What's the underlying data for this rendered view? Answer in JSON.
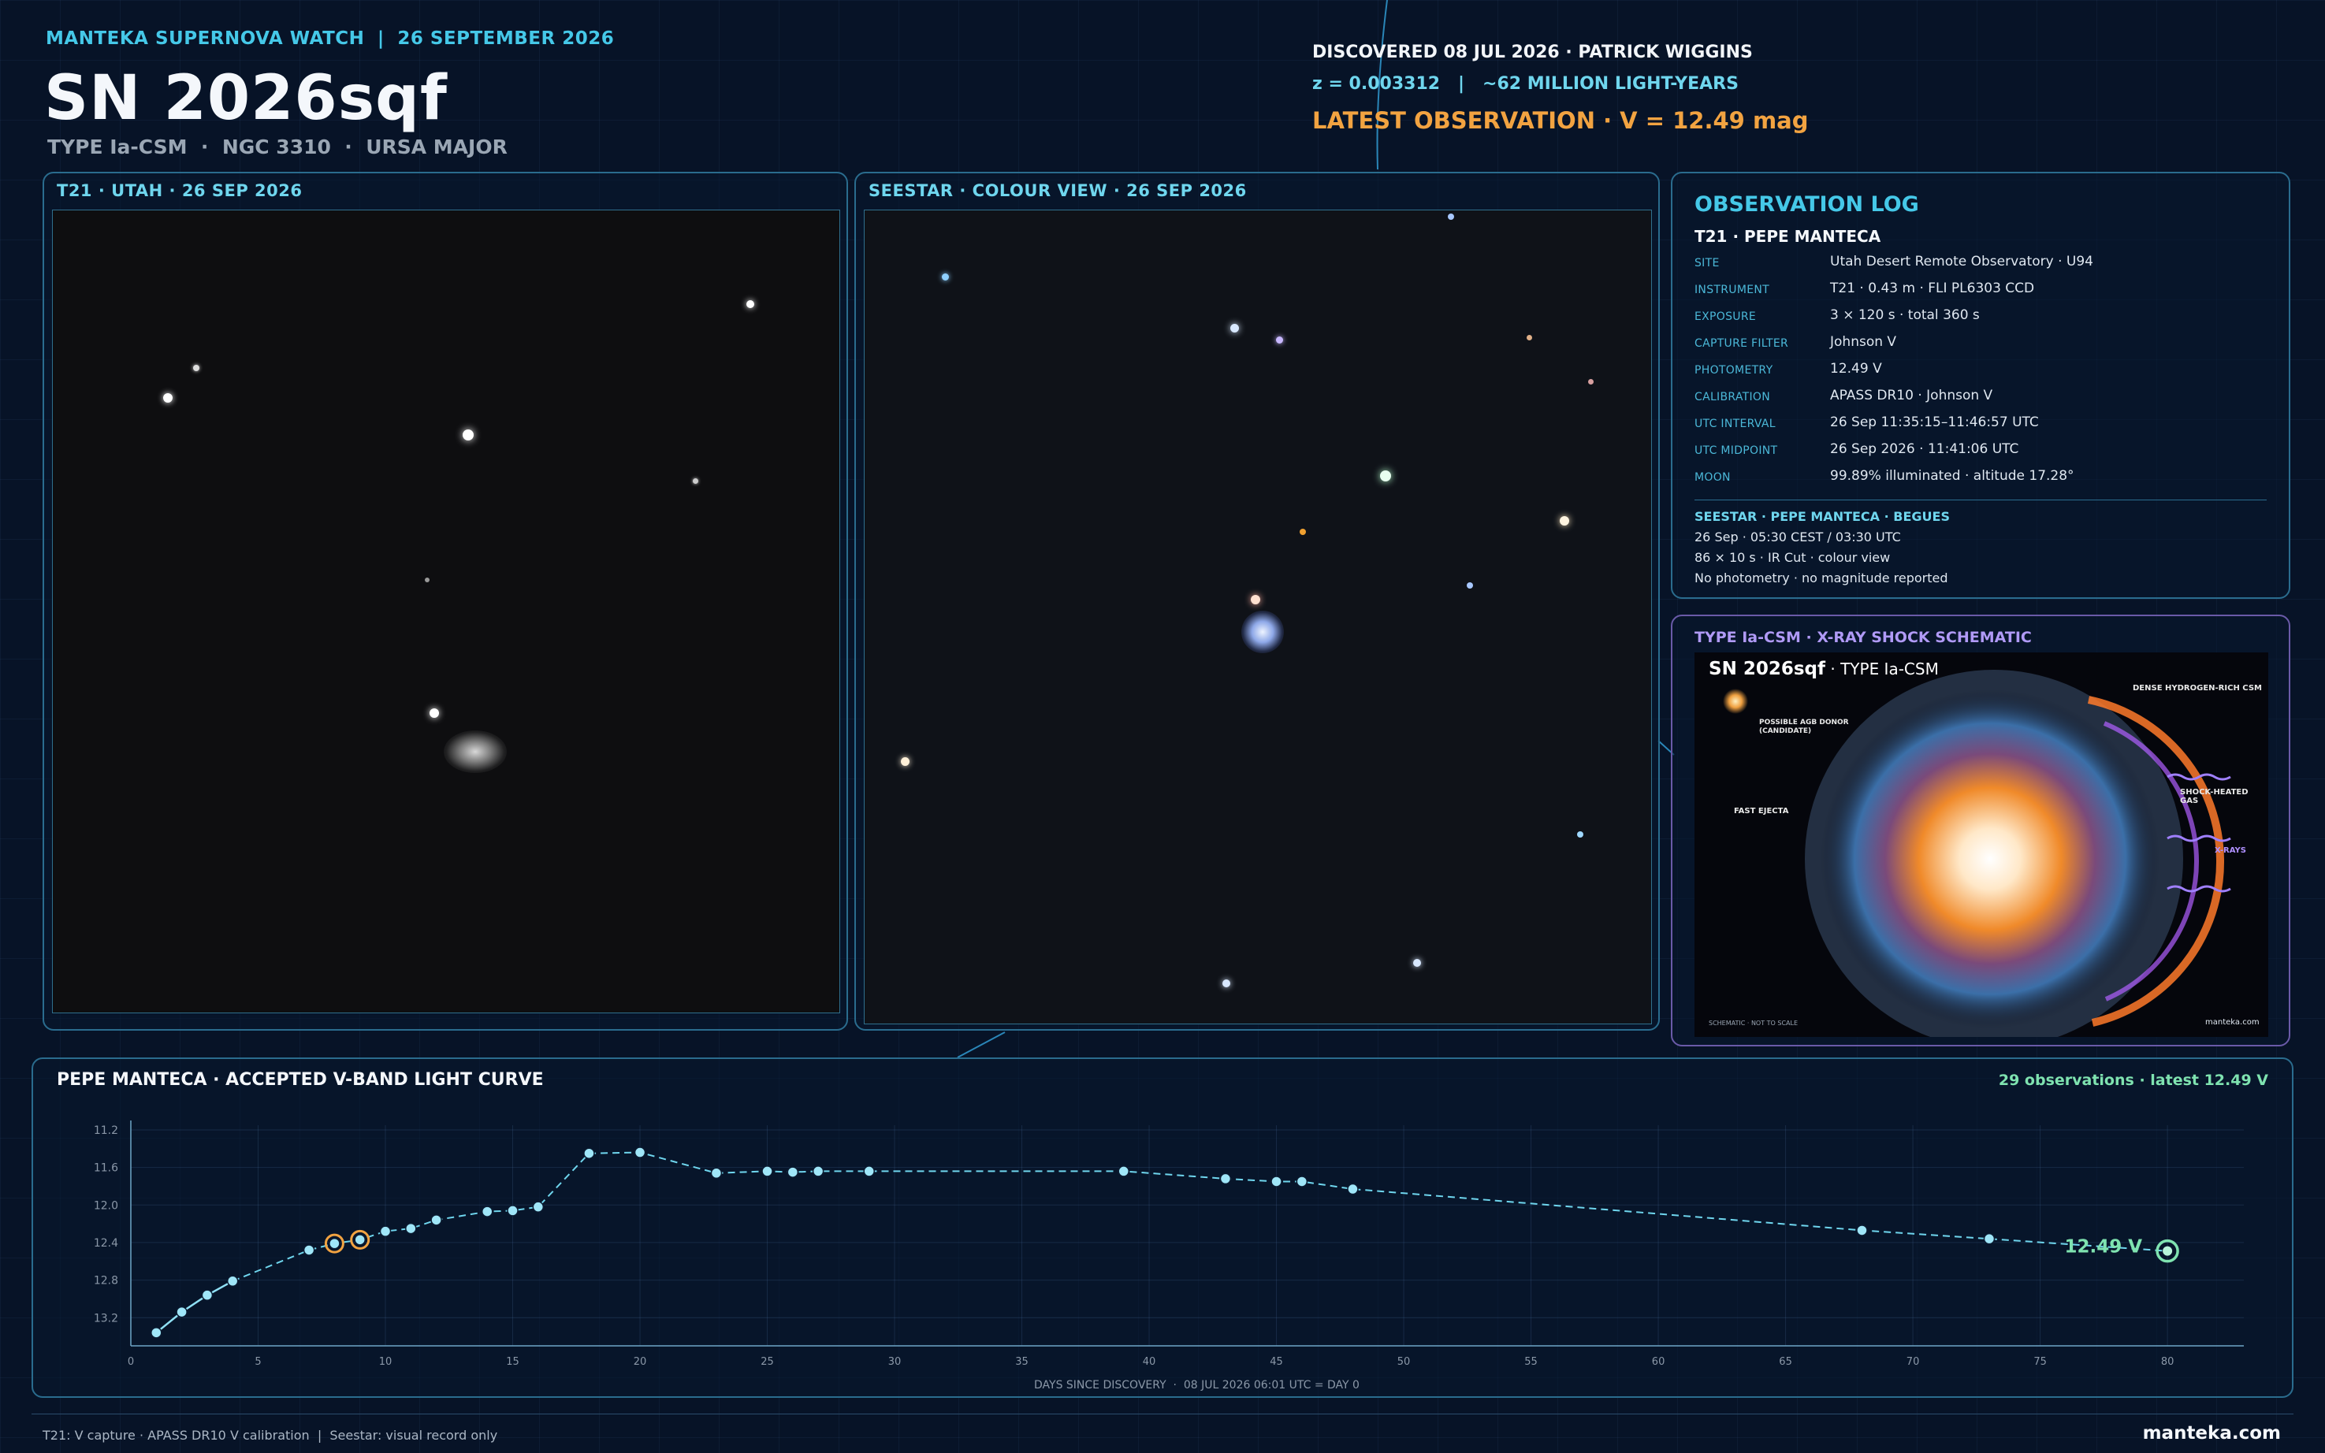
{
  "header": {
    "brand": "MANTEKA SUPERNOVA WATCH",
    "separator": "|",
    "date": "26 SEPTEMBER 2026",
    "title": "SN 2026sqf",
    "subtitle": "TYPE Ia-CSM  ·  NGC 3310  ·  URSA MAJOR",
    "discovered": "DISCOVERED 08 JUL 2026 · PATRICK WIGGINS",
    "redshift": "z = 0.003312   |   ~62 MILLION LIGHT-YEARS",
    "latest": "LATEST OBSERVATION  ·  V = 12.49 mag"
  },
  "t21_panel": {
    "title": "T21 · UTAH · 26 SEP 2026"
  },
  "seestar_panel": {
    "title": "SEESTAR · COLOUR VIEW · 26 SEP 2026"
  },
  "log": {
    "title": "OBSERVATION LOG",
    "subtitle": "T21 · PEPE MANTECA",
    "rows": [
      {
        "key": "SITE",
        "value": "Utah Desert Remote Observatory · U94"
      },
      {
        "key": "INSTRUMENT",
        "value": "T21 · 0.43 m · FLI PL6303 CCD"
      },
      {
        "key": "EXPOSURE",
        "value": "3 × 120 s · total 360 s"
      },
      {
        "key": "CAPTURE FILTER",
        "value": "Johnson V"
      },
      {
        "key": "PHOTOMETRY",
        "value": "12.49 V"
      },
      {
        "key": "CALIBRATION",
        "value": "APASS DR10 · Johnson V"
      },
      {
        "key": "UTC INTERVAL",
        "value": "26 Sep 11:35:15–11:46:57 UTC"
      },
      {
        "key": "UTC MIDPOINT",
        "value": "26 Sep 2026 · 11:41:06 UTC"
      },
      {
        "key": "MOON",
        "value": "99.89% illuminated · altitude 17.28°"
      }
    ],
    "seestar_title": "SEESTAR · PEPE MANTECA · BEGUES",
    "seestar_lines": [
      "26 Sep · 05:30 CEST / 03:30 UTC",
      "86 × 10 s · IR Cut · colour view",
      "No photometry · no magnitude reported"
    ]
  },
  "schematic": {
    "title": "TYPE Ia-CSM · X-RAY SHOCK SCHEMATIC",
    "name": "SN 2026sqf",
    "type": " · TYPE Ia-CSM",
    "donor": "POSSIBLE AGB DONOR",
    "donor2": "(CANDIDATE)",
    "csm": "DENSE HYDROGEN-RICH CSM",
    "ejecta": "FAST EJECTA",
    "shock": "SHOCK-HEATED GAS",
    "xrays": "X-RAYS",
    "note": "SCHEMATIC · NOT TO SCALE",
    "credit": "manteka.com"
  },
  "curve": {
    "title": "PEPE MANTECA · ACCEPTED V-BAND LIGHT CURVE",
    "summary": "29 observations · latest 12.49 V",
    "xlabel": "DAYS SINCE DISCOVERY  ·  08 JUL 2026 06:01 UTC = DAY 0",
    "latest_label": "12.49 V"
  },
  "chart_data": {
    "type": "line",
    "title": "PEPE MANTECA · ACCEPTED V-BAND LIGHT CURVE",
    "xlabel": "DAYS SINCE DISCOVERY  ·  08 JUL 2026 06:01 UTC = DAY 0",
    "ylabel": "",
    "xlim": [
      0,
      83
    ],
    "ylim": [
      13.5,
      11.15
    ],
    "y_inverted": true,
    "grid": true,
    "xticks": [
      0,
      5,
      10,
      15,
      20,
      25,
      30,
      35,
      40,
      45,
      50,
      55,
      60,
      65,
      70,
      75,
      80
    ],
    "yticks": [
      11.2,
      11.6,
      12.0,
      12.4,
      12.8,
      13.2
    ],
    "ytick_labels": [
      "11.2",
      "11.6",
      "12.0",
      "12.4",
      "12.8",
      "13.2"
    ],
    "series": [
      {
        "x": [
          1,
          2,
          3,
          4,
          7,
          8,
          9,
          10,
          11,
          12,
          14,
          15,
          16,
          18,
          20,
          23,
          25,
          26,
          27,
          29,
          39,
          43,
          45,
          46,
          48,
          68,
          73,
          80
        ],
        "y": [
          13.36,
          13.14,
          12.96,
          12.81,
          12.48,
          12.41,
          12.37,
          12.28,
          12.25,
          12.16,
          12.07,
          12.06,
          12.02,
          11.45,
          11.44,
          11.66,
          11.64,
          11.65,
          11.64,
          11.64,
          11.64,
          11.72,
          11.75,
          11.75,
          11.83,
          12.27,
          12.36,
          12.49
        ]
      }
    ],
    "highlighted_x": [
      8,
      9
    ],
    "latest_x": 80,
    "latest_y": 12.49
  },
  "footer": {
    "note": "T21: V capture · APASS DR10 V calibration  |  Seestar: visual record only",
    "site": "manteka.com"
  },
  "colors": {
    "accent": "#45c8e8",
    "orange": "#f2a341",
    "green": "#7fe3b0",
    "purple": "#a98ef0"
  }
}
